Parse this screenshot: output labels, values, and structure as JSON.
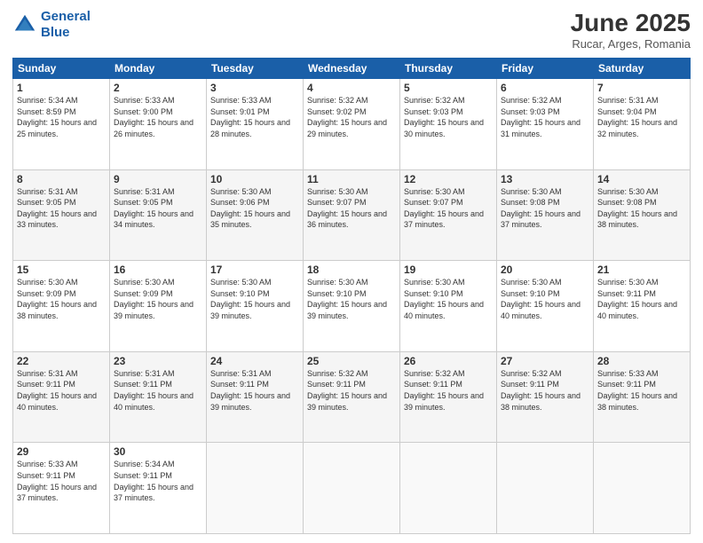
{
  "header": {
    "logo_line1": "General",
    "logo_line2": "Blue",
    "month_year": "June 2025",
    "location": "Rucar, Arges, Romania"
  },
  "days_of_week": [
    "Sunday",
    "Monday",
    "Tuesday",
    "Wednesday",
    "Thursday",
    "Friday",
    "Saturday"
  ],
  "weeks": [
    [
      {
        "day": 1,
        "sunrise": "5:34 AM",
        "sunset": "8:59 PM",
        "daylight": "15 hours and 25 minutes."
      },
      {
        "day": 2,
        "sunrise": "5:33 AM",
        "sunset": "9:00 PM",
        "daylight": "15 hours and 26 minutes."
      },
      {
        "day": 3,
        "sunrise": "5:33 AM",
        "sunset": "9:01 PM",
        "daylight": "15 hours and 28 minutes."
      },
      {
        "day": 4,
        "sunrise": "5:32 AM",
        "sunset": "9:02 PM",
        "daylight": "15 hours and 29 minutes."
      },
      {
        "day": 5,
        "sunrise": "5:32 AM",
        "sunset": "9:03 PM",
        "daylight": "15 hours and 30 minutes."
      },
      {
        "day": 6,
        "sunrise": "5:32 AM",
        "sunset": "9:03 PM",
        "daylight": "15 hours and 31 minutes."
      },
      {
        "day": 7,
        "sunrise": "5:31 AM",
        "sunset": "9:04 PM",
        "daylight": "15 hours and 32 minutes."
      }
    ],
    [
      {
        "day": 8,
        "sunrise": "5:31 AM",
        "sunset": "9:05 PM",
        "daylight": "15 hours and 33 minutes."
      },
      {
        "day": 9,
        "sunrise": "5:31 AM",
        "sunset": "9:05 PM",
        "daylight": "15 hours and 34 minutes."
      },
      {
        "day": 10,
        "sunrise": "5:30 AM",
        "sunset": "9:06 PM",
        "daylight": "15 hours and 35 minutes."
      },
      {
        "day": 11,
        "sunrise": "5:30 AM",
        "sunset": "9:07 PM",
        "daylight": "15 hours and 36 minutes."
      },
      {
        "day": 12,
        "sunrise": "5:30 AM",
        "sunset": "9:07 PM",
        "daylight": "15 hours and 37 minutes."
      },
      {
        "day": 13,
        "sunrise": "5:30 AM",
        "sunset": "9:08 PM",
        "daylight": "15 hours and 37 minutes."
      },
      {
        "day": 14,
        "sunrise": "5:30 AM",
        "sunset": "9:08 PM",
        "daylight": "15 hours and 38 minutes."
      }
    ],
    [
      {
        "day": 15,
        "sunrise": "5:30 AM",
        "sunset": "9:09 PM",
        "daylight": "15 hours and 38 minutes."
      },
      {
        "day": 16,
        "sunrise": "5:30 AM",
        "sunset": "9:09 PM",
        "daylight": "15 hours and 39 minutes."
      },
      {
        "day": 17,
        "sunrise": "5:30 AM",
        "sunset": "9:10 PM",
        "daylight": "15 hours and 39 minutes."
      },
      {
        "day": 18,
        "sunrise": "5:30 AM",
        "sunset": "9:10 PM",
        "daylight": "15 hours and 39 minutes."
      },
      {
        "day": 19,
        "sunrise": "5:30 AM",
        "sunset": "9:10 PM",
        "daylight": "15 hours and 40 minutes."
      },
      {
        "day": 20,
        "sunrise": "5:30 AM",
        "sunset": "9:10 PM",
        "daylight": "15 hours and 40 minutes."
      },
      {
        "day": 21,
        "sunrise": "5:30 AM",
        "sunset": "9:11 PM",
        "daylight": "15 hours and 40 minutes."
      }
    ],
    [
      {
        "day": 22,
        "sunrise": "5:31 AM",
        "sunset": "9:11 PM",
        "daylight": "15 hours and 40 minutes."
      },
      {
        "day": 23,
        "sunrise": "5:31 AM",
        "sunset": "9:11 PM",
        "daylight": "15 hours and 40 minutes."
      },
      {
        "day": 24,
        "sunrise": "5:31 AM",
        "sunset": "9:11 PM",
        "daylight": "15 hours and 39 minutes."
      },
      {
        "day": 25,
        "sunrise": "5:32 AM",
        "sunset": "9:11 PM",
        "daylight": "15 hours and 39 minutes."
      },
      {
        "day": 26,
        "sunrise": "5:32 AM",
        "sunset": "9:11 PM",
        "daylight": "15 hours and 39 minutes."
      },
      {
        "day": 27,
        "sunrise": "5:32 AM",
        "sunset": "9:11 PM",
        "daylight": "15 hours and 38 minutes."
      },
      {
        "day": 28,
        "sunrise": "5:33 AM",
        "sunset": "9:11 PM",
        "daylight": "15 hours and 38 minutes."
      }
    ],
    [
      {
        "day": 29,
        "sunrise": "5:33 AM",
        "sunset": "9:11 PM",
        "daylight": "15 hours and 37 minutes."
      },
      {
        "day": 30,
        "sunrise": "5:34 AM",
        "sunset": "9:11 PM",
        "daylight": "15 hours and 37 minutes."
      },
      null,
      null,
      null,
      null,
      null
    ]
  ]
}
